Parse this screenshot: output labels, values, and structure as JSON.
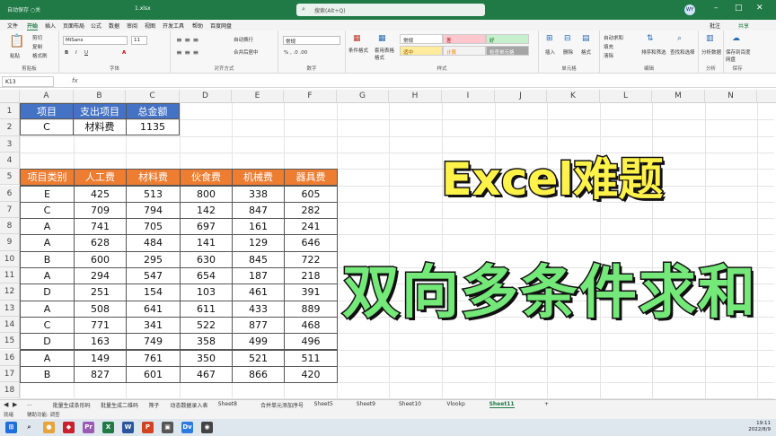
{
  "titlebar": {
    "autosave": "自动保存 ○关",
    "filename": "1.xlsx",
    "search": "搜索(Alt+Q)",
    "avatar": "WY"
  },
  "menu": [
    "文件",
    "开始",
    "插入",
    "页面布局",
    "公式",
    "数据",
    "审阅",
    "视图",
    "开发工具",
    "帮助",
    "百度网盘"
  ],
  "menu_right": [
    "批注",
    "共享"
  ],
  "ribbon": {
    "clipboard": {
      "paste": "粘贴",
      "cut": "剪切",
      "copy": "复制",
      "format_painter": "格式刷",
      "label": "剪贴板"
    },
    "font": {
      "name": "MiSans",
      "size": "11",
      "label": "字体"
    },
    "align": {
      "wrap": "自动换行",
      "merge": "合并后居中",
      "label": "对齐方式"
    },
    "number": {
      "format": "常规",
      "label": "数字"
    },
    "styles": {
      "cond": "条件格式",
      "table": "套用表格格式",
      "cells": [
        "常规",
        "差",
        "好",
        "适中",
        "计算",
        "检查单元格"
      ],
      "label": "样式"
    },
    "cells": {
      "insert": "插入",
      "delete": "删除",
      "format": "格式",
      "label": "单元格"
    },
    "edit": {
      "autosum": "自动求和",
      "fill": "填充",
      "clear": "清除",
      "sort": "排序和筛选",
      "find": "查找和选择",
      "label": "编辑"
    },
    "analysis": {
      "btn": "分析数据",
      "label": "分析"
    },
    "save": {
      "btn": "保存到百度网盘",
      "label": "保存"
    }
  },
  "formula_bar": {
    "namebox": "K13",
    "fx": "fx"
  },
  "columns": [
    "A",
    "B",
    "C",
    "D",
    "E",
    "F",
    "G",
    "H",
    "I",
    "J",
    "K",
    "L",
    "M",
    "N"
  ],
  "rows": [
    "1",
    "2",
    "3",
    "4",
    "5",
    "6",
    "7",
    "8",
    "9",
    "10",
    "11",
    "12",
    "13",
    "14",
    "15",
    "16",
    "17",
    "18"
  ],
  "summary_table": {
    "headers": [
      "项目",
      "支出项目",
      "总金额"
    ],
    "row": [
      "C",
      "材料费",
      "1135"
    ]
  },
  "data_table": {
    "headers": [
      "项目类别",
      "人工费",
      "材料费",
      "伙食费",
      "机械费",
      "器具费"
    ],
    "rows": [
      [
        "E",
        "425",
        "513",
        "800",
        "338",
        "605"
      ],
      [
        "C",
        "709",
        "794",
        "142",
        "847",
        "282"
      ],
      [
        "A",
        "741",
        "705",
        "697",
        "161",
        "241"
      ],
      [
        "A",
        "628",
        "484",
        "141",
        "129",
        "646"
      ],
      [
        "B",
        "600",
        "295",
        "630",
        "845",
        "722"
      ],
      [
        "A",
        "294",
        "547",
        "654",
        "187",
        "218"
      ],
      [
        "D",
        "251",
        "154",
        "103",
        "461",
        "391"
      ],
      [
        "A",
        "508",
        "641",
        "611",
        "433",
        "889"
      ],
      [
        "C",
        "771",
        "341",
        "522",
        "877",
        "468"
      ],
      [
        "D",
        "163",
        "749",
        "358",
        "499",
        "496"
      ],
      [
        "A",
        "149",
        "761",
        "350",
        "521",
        "511"
      ],
      [
        "B",
        "827",
        "601",
        "467",
        "866",
        "420"
      ]
    ]
  },
  "overlay": {
    "title1": "Excel难题",
    "title2": "双向多条件求和"
  },
  "sheet_tabs": [
    "...",
    "批量生成条形码",
    "批量生成二维码",
    "筛子",
    "动态数据录入表",
    "Sheet8",
    "合并单元添加序号",
    "Sheet5",
    "Sheet9",
    "Sheet10",
    "Vlookp",
    "Sheet11"
  ],
  "active_tab": "Sheet11",
  "status": {
    "ready": "就绪",
    "accessibility": "辅助功能: 调查"
  },
  "clock": {
    "time": "19:11",
    "date": "2022/8/9"
  },
  "colors": {
    "summary_header": "#4472c4",
    "data_header": "#ed7d31",
    "title1": "#fff34a",
    "title2": "#74e879",
    "excel_green": "#1f7a45"
  }
}
